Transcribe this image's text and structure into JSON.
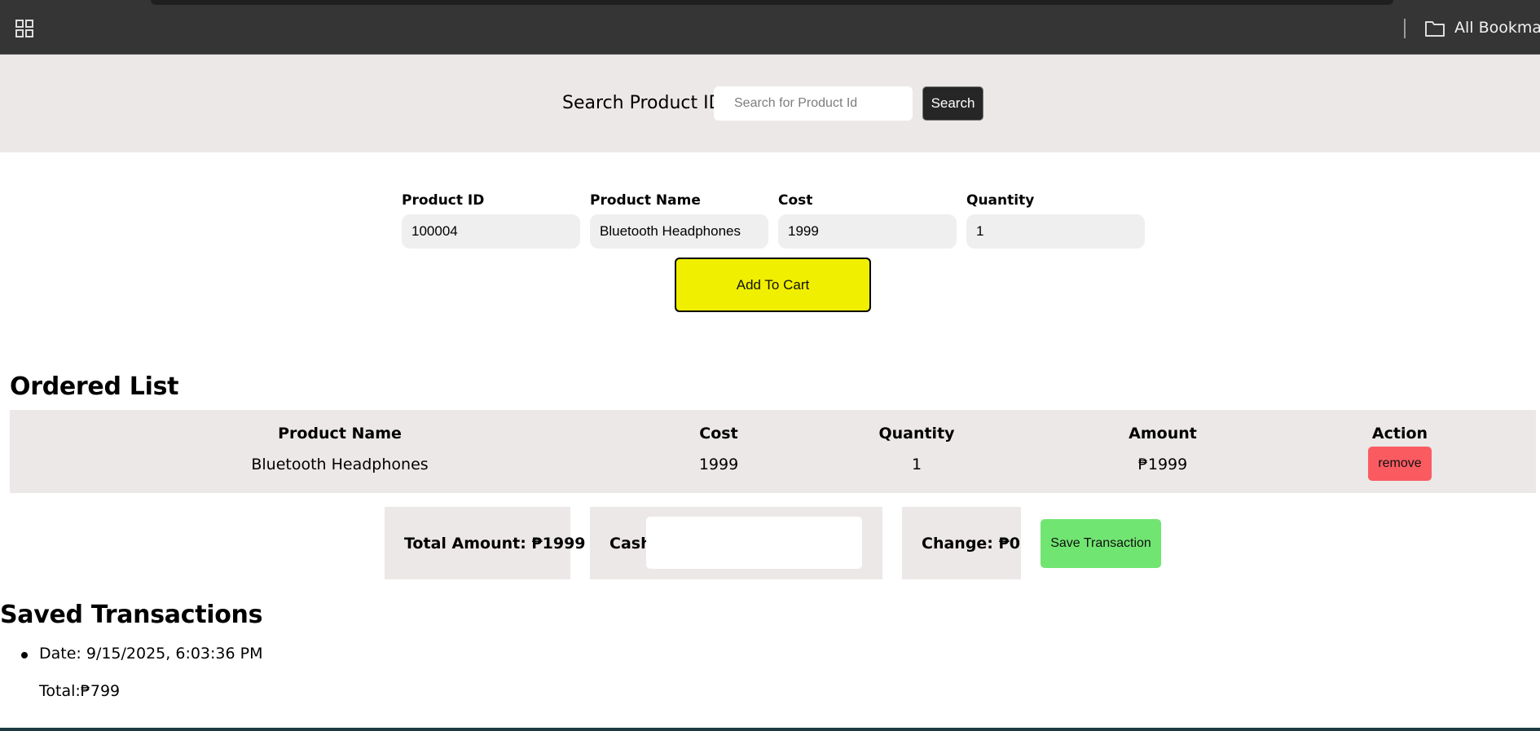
{
  "browser": {
    "apps_icon": "apps-grid-icon",
    "bookmarks_folder_icon": "folder-icon",
    "bookmarks_label": "All Bookmarks"
  },
  "search": {
    "label": "Search Product ID",
    "placeholder": "Search for Product Id",
    "button": "Search"
  },
  "form": {
    "fields": [
      {
        "label": "Product ID",
        "value": "100004"
      },
      {
        "label": "Product Name",
        "value": "Bluetooth Headphones"
      },
      {
        "label": "Cost",
        "value": "1999"
      },
      {
        "label": "Quantity",
        "value": "1"
      }
    ],
    "add_button": "Add To Cart",
    "add_button_color": "#f0ef00"
  },
  "ordered_list": {
    "title": "Ordered List",
    "columns": [
      "Product Name",
      "Cost",
      "Quantity",
      "Amount",
      "Action"
    ],
    "rows": [
      {
        "product_name": "Bluetooth Headphones",
        "cost": "1999",
        "quantity": "1",
        "amount": "₱1999",
        "action": "remove"
      }
    ],
    "remove_color": "#fa5b61"
  },
  "totals": {
    "total_amount": "Total Amount: ₱1999",
    "cash_label": "Cash:",
    "cash_value": "",
    "change": "Change: ₱0",
    "save_button": "Save Transaction",
    "save_color": "#71e571"
  },
  "saved": {
    "title": "Saved Transactions",
    "items": [
      {
        "date": "Date: 9/15/2025, 6:03:36 PM",
        "total": "Total:₱799"
      }
    ]
  }
}
